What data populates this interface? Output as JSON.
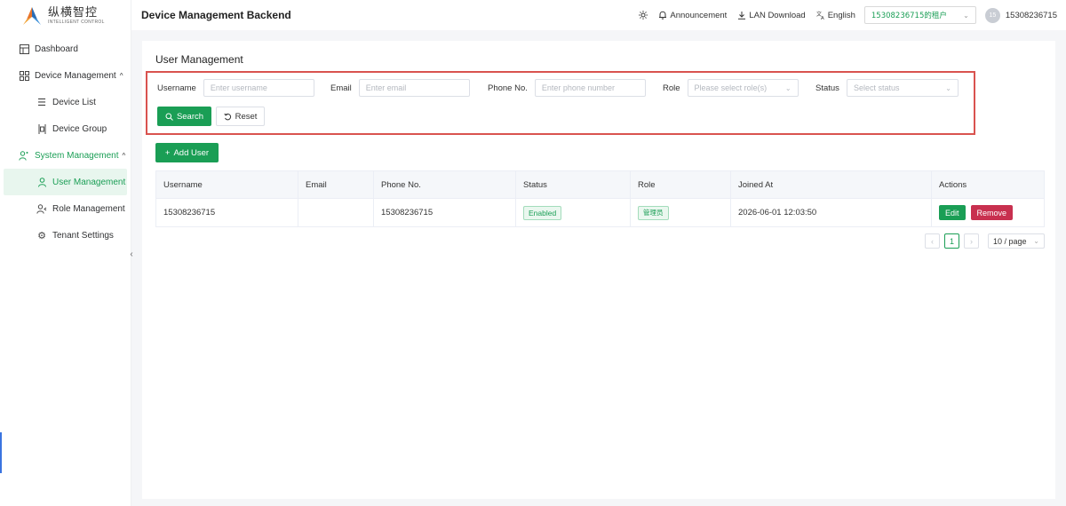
{
  "brand": {
    "name_cn": "纵横智控",
    "name_en": "INTELLIGENT CONTROL"
  },
  "sidebar": {
    "items": [
      {
        "label": "Dashboard",
        "icon": "dashboard-icon"
      },
      {
        "label": "Device Management",
        "icon": "device-management-icon",
        "expanded": true
      },
      {
        "label": "Device List",
        "icon": "list-icon"
      },
      {
        "label": "Device Group",
        "icon": "group-icon"
      },
      {
        "label": "System Management",
        "icon": "system-users-icon",
        "expanded": true
      },
      {
        "label": "User Management",
        "icon": "user-icon",
        "active": true
      },
      {
        "label": "Role Management",
        "icon": "role-icon"
      },
      {
        "label": "Tenant Settings",
        "icon": "gear-icon"
      }
    ]
  },
  "header": {
    "title": "Device Management Backend",
    "announcement": "Announcement",
    "lan_download": "LAN Download",
    "language": "English",
    "tenant": "15308236715的租户",
    "avatar_initials": "15",
    "username": "15308236715"
  },
  "page": {
    "title": "User Management",
    "filters": {
      "username_label": "Username",
      "username_placeholder": "Enter username",
      "email_label": "Email",
      "email_placeholder": "Enter email",
      "phone_label": "Phone No.",
      "phone_placeholder": "Enter phone number",
      "role_label": "Role",
      "role_placeholder": "Please select role(s)",
      "status_label": "Status",
      "status_placeholder": "Select status"
    },
    "search_label": "Search",
    "reset_label": "Reset",
    "add_user_label": "Add User"
  },
  "table": {
    "columns": [
      "Username",
      "Email",
      "Phone No.",
      "Status",
      "Role",
      "Joined At",
      "Actions"
    ],
    "rows": [
      {
        "username": "15308236715",
        "email": "",
        "phone": "15308236715",
        "status": "Enabled",
        "role": "管理员",
        "joined_at": "2026-06-01 12:03:50",
        "edit_label": "Edit",
        "remove_label": "Remove"
      }
    ]
  },
  "pagination": {
    "current_page": "1",
    "page_size": "10 / page"
  },
  "colors": {
    "accent": "#1a9e55",
    "danger": "#c8304f",
    "highlight_border": "#d9534f"
  }
}
